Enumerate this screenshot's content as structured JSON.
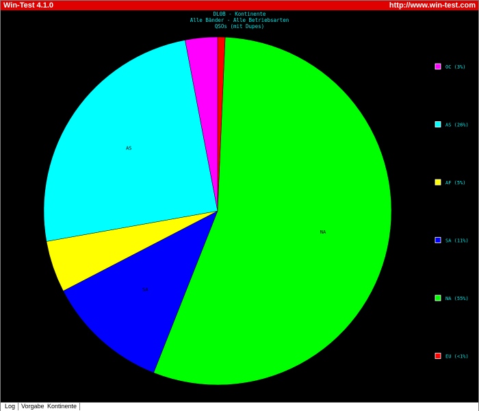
{
  "window": {
    "title": "Win-Test 4.1.0",
    "url": "http://www.win-test.com"
  },
  "tabs": [
    {
      "label": "Log"
    },
    {
      "label": "Vorgabe"
    },
    {
      "label": "Kontinente"
    }
  ],
  "chart_data": {
    "type": "pie",
    "title_lines": [
      "DL0B - Kontinente",
      "Alle Bänder - Alle Betriebsarten",
      "QSOs (mit Dupes)"
    ],
    "slices": [
      {
        "code": "EU",
        "legend": "EU (<1%)",
        "value": 0.7,
        "color": "#ff0000",
        "label": ""
      },
      {
        "code": "NA",
        "legend": "NA (55%)",
        "value": 55.3,
        "color": "#00ff00",
        "label": "NA"
      },
      {
        "code": "SA",
        "legend": "SA (11%)",
        "value": 11.4,
        "color": "#0000ff",
        "label": "SA"
      },
      {
        "code": "AF",
        "legend": "AF (5%)",
        "value": 4.8,
        "color": "#ffff00",
        "label": ""
      },
      {
        "code": "AS",
        "legend": "AS (26%)",
        "value": 24.8,
        "color": "#00ffff",
        "label": "AS"
      },
      {
        "code": "OC",
        "legend": "OC (3%)",
        "value": 3.0,
        "color": "#ff00ff",
        "label": ""
      }
    ],
    "legend_order": [
      "OC",
      "AS",
      "AF",
      "SA",
      "NA",
      "EU"
    ],
    "title_color": "#00e5e5",
    "legend_text_color": "#00e5e5",
    "background": "#000000"
  }
}
